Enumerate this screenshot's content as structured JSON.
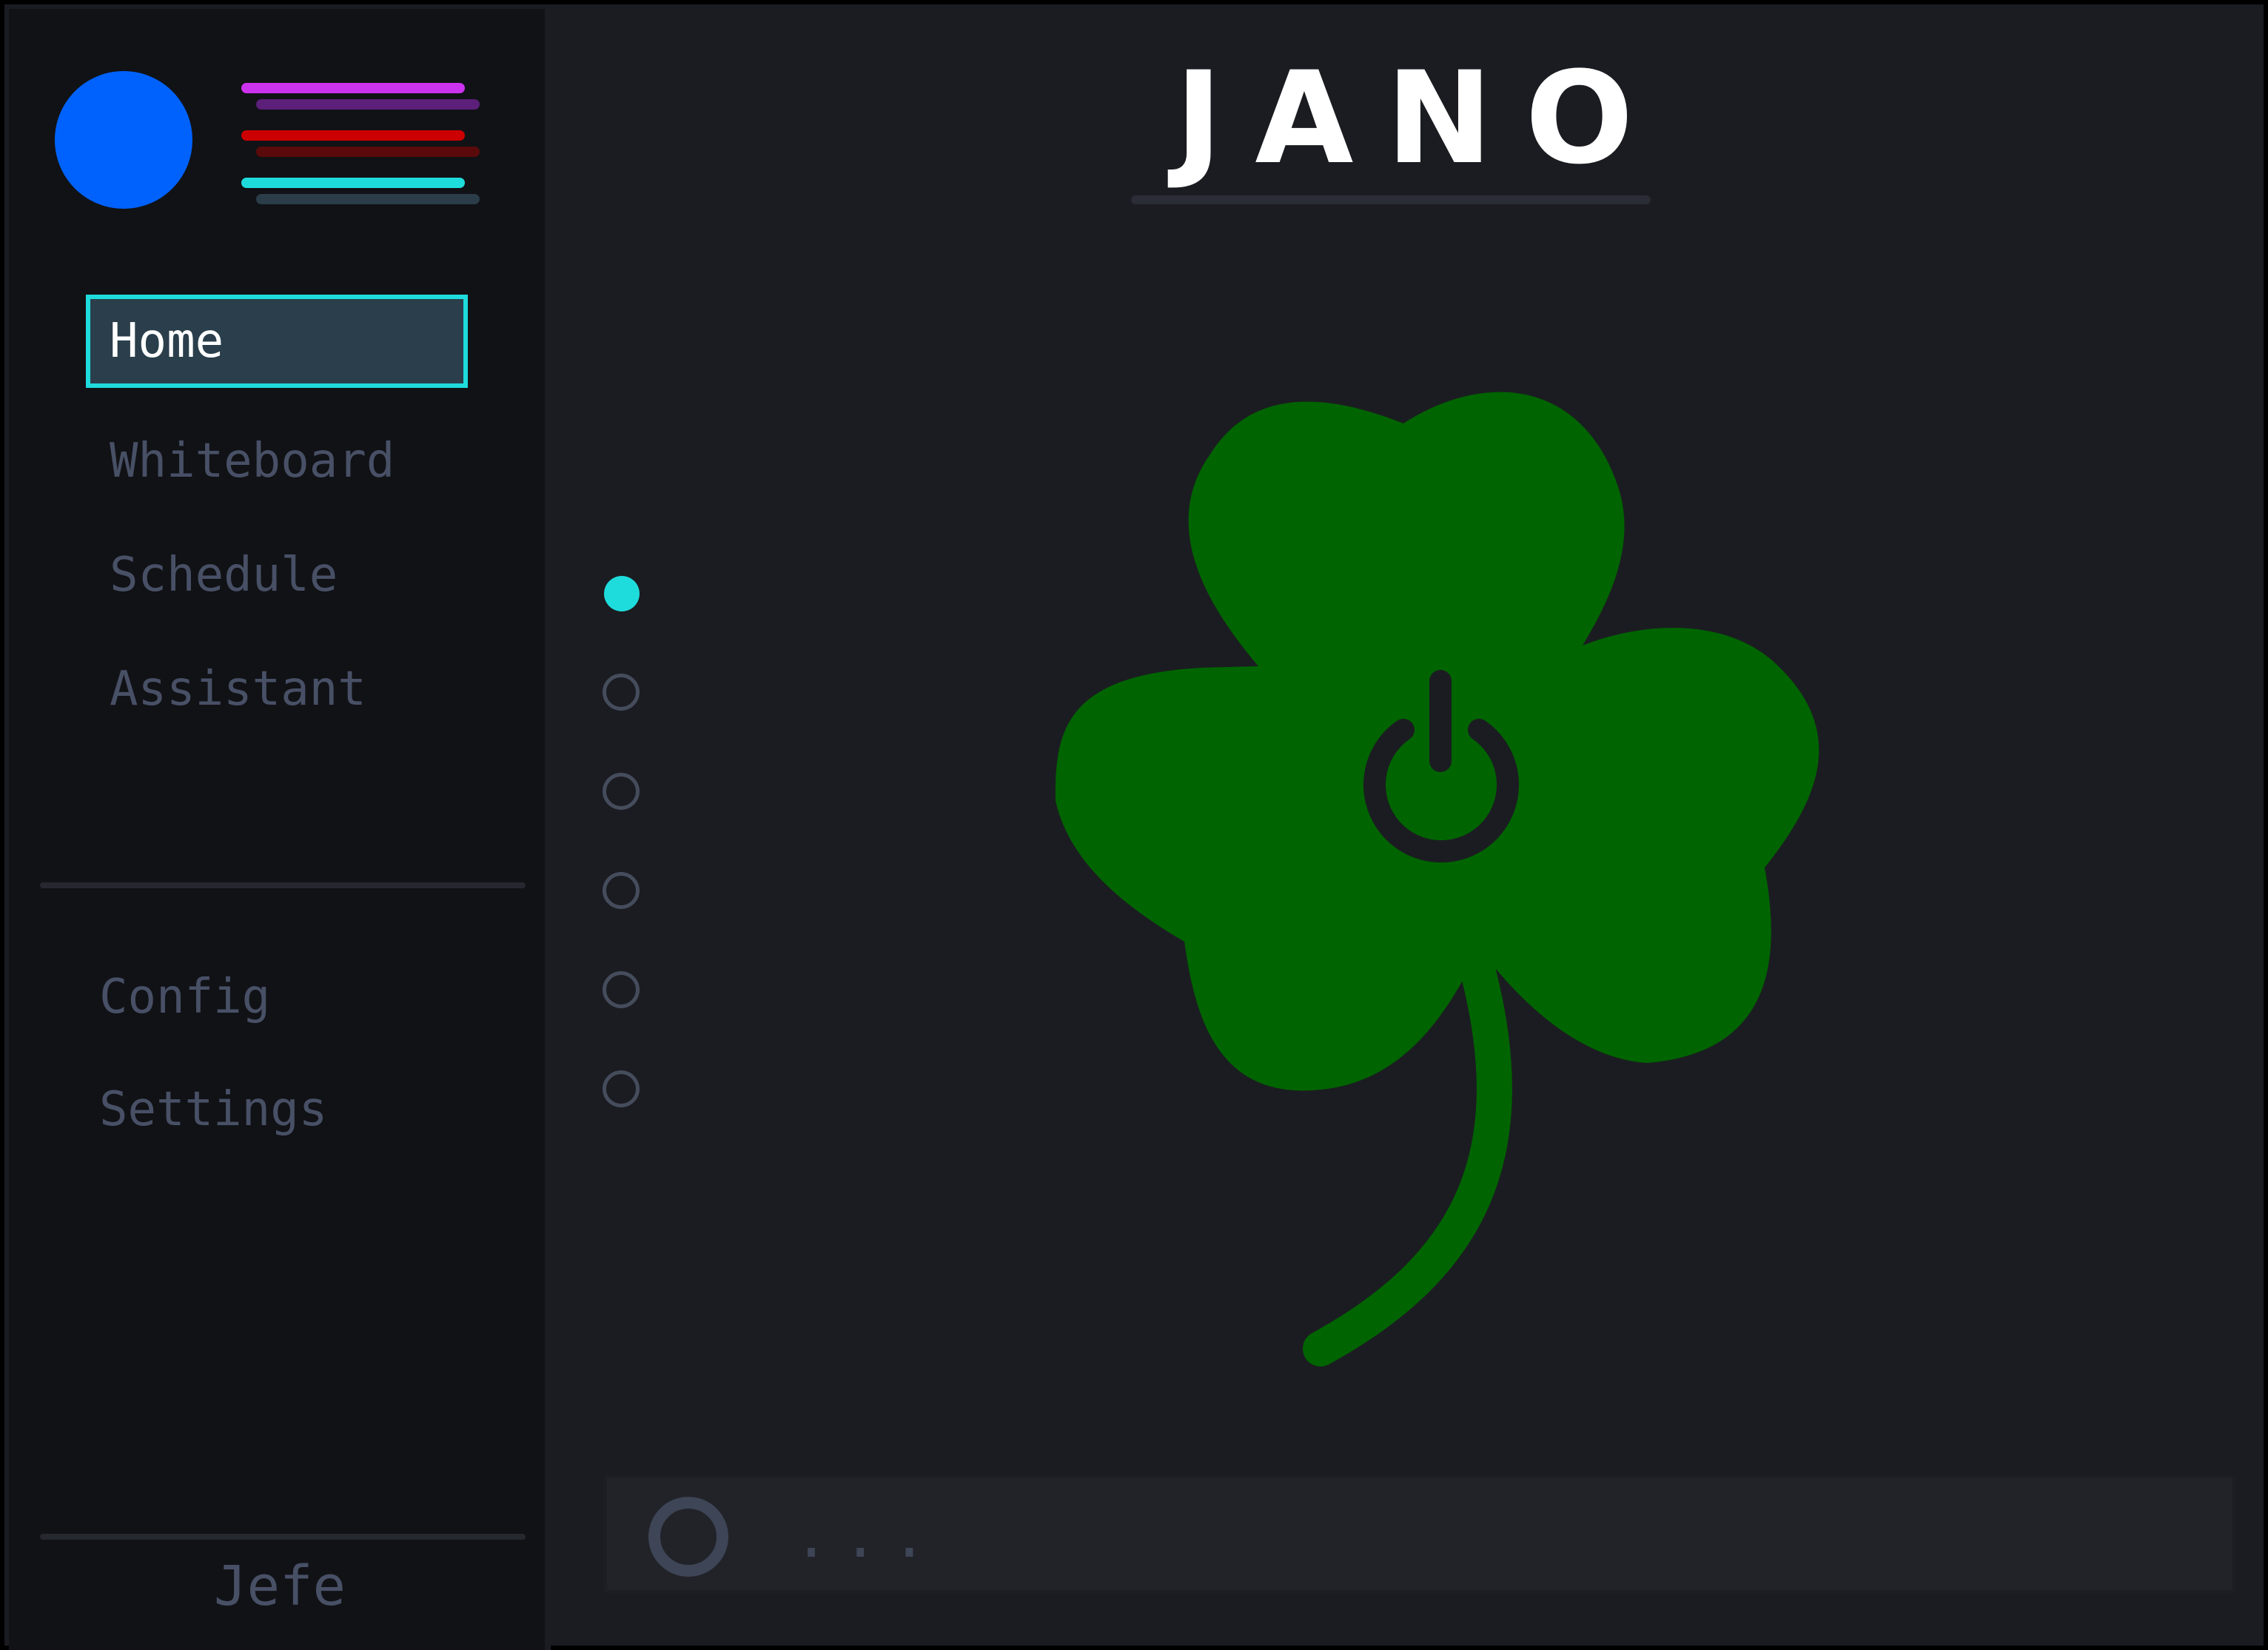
{
  "app": {
    "title": "JANO"
  },
  "colors": {
    "accent": "#1fdcdc",
    "logo": "#0062fc",
    "clover": "#006400",
    "bar_purple": "#cc33ee",
    "bar_red": "#cc0000",
    "bar_cyan": "#1fdcdc"
  },
  "sidebar": {
    "nav": [
      {
        "label": "Home",
        "active": true
      },
      {
        "label": "Whiteboard",
        "active": false
      },
      {
        "label": "Schedule",
        "active": false
      },
      {
        "label": "Assistant",
        "active": false
      }
    ],
    "secondary": [
      {
        "label": "Config"
      },
      {
        "label": "Settings"
      }
    ],
    "user": {
      "name": "Jefe"
    }
  },
  "pager": {
    "count": 6,
    "active_index": 0
  },
  "center": {
    "icon": "clover-power-icon"
  },
  "input": {
    "value": "..."
  }
}
